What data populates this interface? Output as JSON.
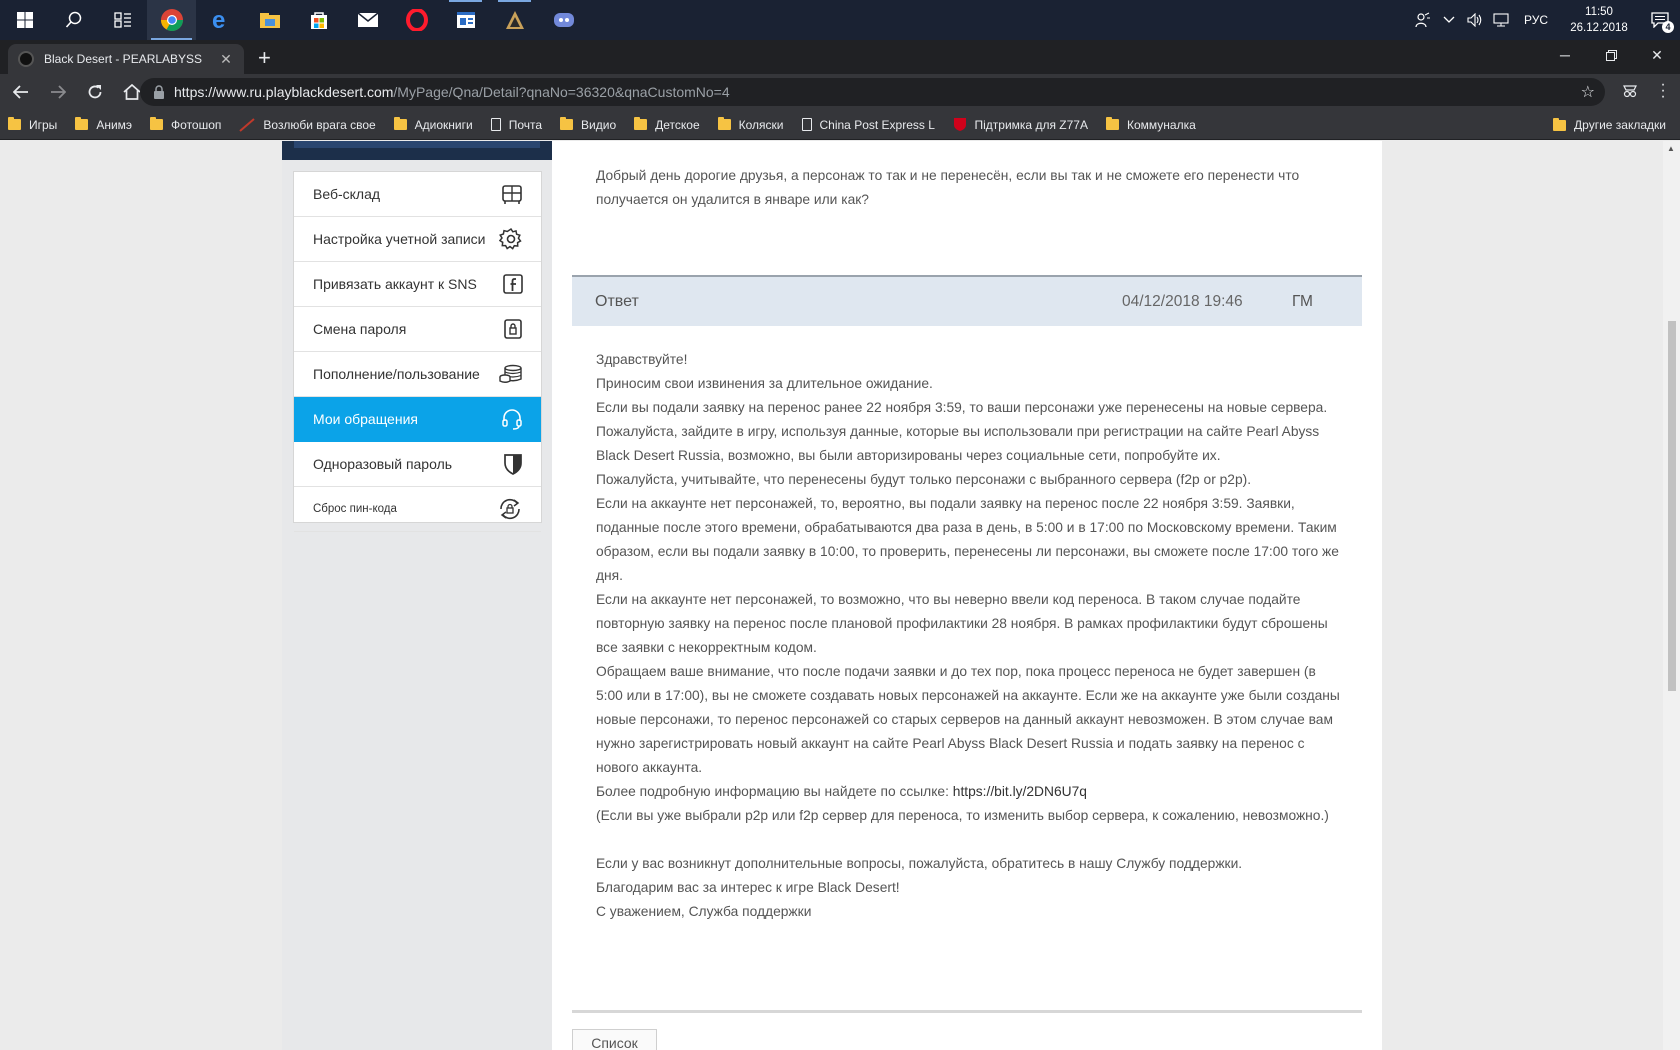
{
  "taskbar": {
    "apps": [
      "start",
      "search",
      "task-view",
      "chrome",
      "edge",
      "file-explorer",
      "store",
      "mail",
      "opera",
      "app-window",
      "game-launcher",
      "discord"
    ],
    "tray": {
      "language": "РУС",
      "time": "11:50",
      "date": "26.12.2018",
      "notification_count": "4"
    }
  },
  "browser": {
    "tab_title": "Black Desert - PEARLABYSS",
    "url_host": "https://www.ru.playblackdesert.com",
    "url_path": "/MyPage/Qna/Detail?qnaNo=36320&qnaCustomNo=4",
    "bookmarks": [
      {
        "label": "Игры",
        "icon": "folder"
      },
      {
        "label": "Анимэ",
        "icon": "folder"
      },
      {
        "label": "Фотошоп",
        "icon": "folder"
      },
      {
        "label": "Возлюби врага свое",
        "icon": "feather"
      },
      {
        "label": "Адиокниги",
        "icon": "folder"
      },
      {
        "label": "Почта",
        "icon": "page"
      },
      {
        "label": "Видио",
        "icon": "folder"
      },
      {
        "label": "Детское",
        "icon": "folder"
      },
      {
        "label": "Коляски",
        "icon": "folder"
      },
      {
        "label": "China Post Express Lc",
        "icon": "page"
      },
      {
        "label": "Підтримка для Z77A",
        "icon": "shield"
      },
      {
        "label": "Коммуналка",
        "icon": "folder"
      }
    ],
    "other_bookmarks": "Другие закладки"
  },
  "sidebar": {
    "items": [
      {
        "label": "Веб-склад",
        "icon": "storage-icon"
      },
      {
        "label": "Настройка учетной записи",
        "icon": "gear-icon"
      },
      {
        "label": "Привязать аккаунт к SNS",
        "icon": "facebook-icon"
      },
      {
        "label": "Смена пароля",
        "icon": "lock-icon"
      },
      {
        "label": "Пополнение/пользование",
        "icon": "coins-icon"
      },
      {
        "label": "Мои обращения",
        "icon": "headset-icon",
        "active": true
      },
      {
        "label": "Одноразовый пароль",
        "icon": "shield-icon"
      },
      {
        "label": "Сброс пин-кода",
        "icon": "reset-icon"
      }
    ]
  },
  "question": {
    "text": "Добрый день дорогие друзья, а персонаж то так и не перенесён, если вы так и не сможете его перенести что получается он удалится в январе или как?"
  },
  "answer": {
    "label": "Ответ",
    "date": "04/12/2018 19:46",
    "author": "ГМ",
    "paragraphs": [
      "Здравствуйте!",
      "Приносим свои извинения за длительное ожидание.",
      "Если вы подали заявку на перенос ранее 22 ноября 3:59, то ваши персонажи уже перенесены на новые сервера. Пожалуйста, зайдите в игру, используя данные, которые вы использовали при регистрации на сайте Pearl Abyss Black Desert Russia, возможно, вы были авторизированы через социальные сети, попробуйте их.",
      "Пожалуйста, учитывайте, что перенесены будут только персонажи с выбранного сервера (f2p or p2p).",
      "Если на аккаунте нет персонажей, то, вероятно, вы подали заявку на перенос после 22 ноября 3:59. Заявки, поданные после этого времени, обрабатываются два раза в день, в 5:00 и в 17:00 по Московскому времени. Таким образом, если вы подали заявку в 10:00, то проверить, перенесены ли персонажи, вы сможете после 17:00 того же дня.",
      "Если на аккаунте нет персонажей, то возможно, что вы неверно ввели код переноса. В таком случае подайте повторную заявку на перенос после плановой профилактики 28 ноября. В рамках профилактики будут сброшены все заявки с некорректным кодом.",
      "Обращаем ваше внимание, что после подачи заявки и до тех пор, пока процесс переноса не будет завершен (в 5:00 или в 17:00), вы не сможете создавать новых персонажей на аккаунте. Если же на аккаунте уже были созданы новые персонажи, то перенос персонажей со старых серверов на данный аккаунт невозможен. В этом случае вам нужно зарегистрировать новый аккаунт на сайте Pearl Abyss Black Desert Russia и подать заявку на перенос с нового аккаунта."
    ],
    "link_prefix": "Более подробную информацию вы найдете по ссылке: ",
    "link_text": "https://bit.ly/2DN6U7q",
    "note": "(Если вы уже выбрали p2p или f2p сервер для переноса, то изменить выбор сервера, к сожалению, невозможно.)",
    "closing": [
      "Если у вас возникнут дополнительные вопросы, пожалуйста, обратитесь в нашу Службу поддержки.",
      "Благодарим вас за интерес к игре Black Desert!",
      "С уважением, Служба поддержки"
    ]
  },
  "list_button": "Список",
  "colors": {
    "active_menu": "#0ba3e8",
    "answer_header_bg": "#dfe7f0",
    "taskbar_bg": "#1a2233",
    "chrome_dark": "#35363a"
  }
}
